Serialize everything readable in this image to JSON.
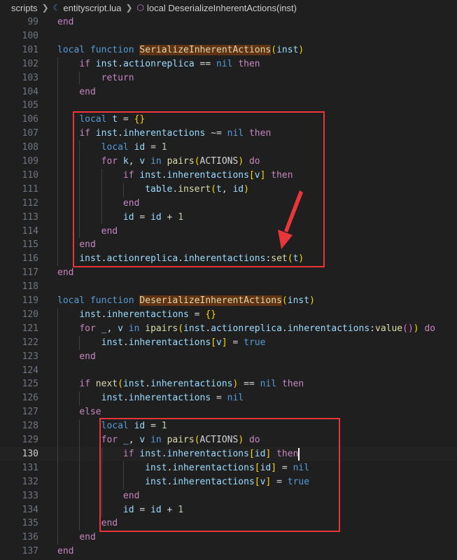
{
  "breadcrumb": {
    "folder": "scripts",
    "file": "entityscript.lua",
    "symbol": "local DeserializeInherentActions(inst)"
  },
  "editor": {
    "current_line": "130",
    "annotation_color": "#e8363a",
    "lines": [
      {
        "n": "99",
        "t": "end"
      },
      {
        "n": "100",
        "t": ""
      },
      {
        "n": "101",
        "t": "local function SerializeInherentActions(inst)"
      },
      {
        "n": "102",
        "t": "    if inst.actionreplica == nil then"
      },
      {
        "n": "103",
        "t": "        return"
      },
      {
        "n": "104",
        "t": "    end"
      },
      {
        "n": "105",
        "t": ""
      },
      {
        "n": "106",
        "t": "    local t = {}"
      },
      {
        "n": "107",
        "t": "    if inst.inherentactions ~= nil then"
      },
      {
        "n": "108",
        "t": "        local id = 1"
      },
      {
        "n": "109",
        "t": "        for k, v in pairs(ACTIONS) do"
      },
      {
        "n": "110",
        "t": "            if inst.inherentactions[v] then"
      },
      {
        "n": "111",
        "t": "                table.insert(t, id)"
      },
      {
        "n": "112",
        "t": "            end"
      },
      {
        "n": "113",
        "t": "            id = id + 1"
      },
      {
        "n": "114",
        "t": "        end"
      },
      {
        "n": "115",
        "t": "    end"
      },
      {
        "n": "116",
        "t": "    inst.actionreplica.inherentactions:set(t)"
      },
      {
        "n": "117",
        "t": "end"
      },
      {
        "n": "118",
        "t": ""
      },
      {
        "n": "119",
        "t": "local function DeserializeInherentActions(inst)"
      },
      {
        "n": "120",
        "t": "    inst.inherentactions = {}"
      },
      {
        "n": "121",
        "t": "    for _, v in ipairs(inst.actionreplica.inherentactions:value()) do"
      },
      {
        "n": "122",
        "t": "        inst.inherentactions[v] = true"
      },
      {
        "n": "123",
        "t": "    end"
      },
      {
        "n": "124",
        "t": ""
      },
      {
        "n": "125",
        "t": "    if next(inst.inherentactions) == nil then"
      },
      {
        "n": "126",
        "t": "        inst.inherentactions = nil"
      },
      {
        "n": "127",
        "t": "    else"
      },
      {
        "n": "128",
        "t": "        local id = 1"
      },
      {
        "n": "129",
        "t": "        for _, v in pairs(ACTIONS) do"
      },
      {
        "n": "130",
        "t": "            if inst.inherentactions[id] then"
      },
      {
        "n": "131",
        "t": "                inst.inherentactions[id] = nil"
      },
      {
        "n": "132",
        "t": "                inst.inherentactions[v] = true"
      },
      {
        "n": "133",
        "t": "            end"
      },
      {
        "n": "134",
        "t": "            id = id + 1"
      },
      {
        "n": "135",
        "t": "        end"
      },
      {
        "n": "136",
        "t": "    end"
      },
      {
        "n": "137",
        "t": "end"
      }
    ]
  },
  "colors": {
    "background": "#1f1f1f",
    "keyword": "#569cd6",
    "control": "#c586c0",
    "function": "#dcdcaa",
    "variable": "#9cdcfe",
    "number": "#b5cea8",
    "bracket": "#ffd700",
    "match_highlight": "#613214"
  }
}
